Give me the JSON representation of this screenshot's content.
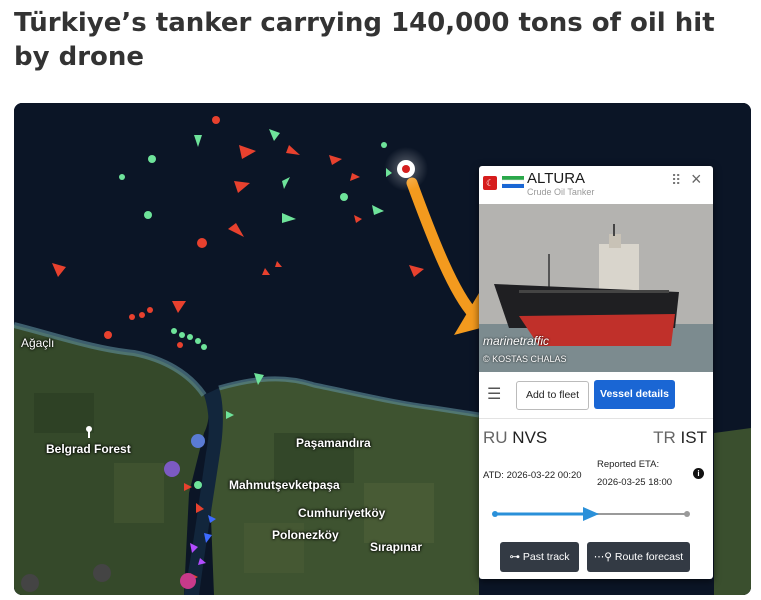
{
  "headline": "Türkiye’s tanker carrying 140,000 tons of oil hit by drone",
  "map": {
    "place_labels": {
      "agacli": "Ağaçlı",
      "belgrad": "Belgrad Forest",
      "pasamandira": "Paşamandıra",
      "mahmutsevketpasa": "Mahmutşevketpaşa",
      "cumhuriyetkoy": "Cumhuriyetköy",
      "polonezkoy": "Polonezköy",
      "sirapinar": "Sırapınar"
    },
    "colors": {
      "sea": "#0b1526",
      "land": "#35492a",
      "vessel_tanker": "#e8412e",
      "vessel_cargo": "#6ee39a",
      "arrow": "#f39a1e"
    }
  },
  "vessel_card": {
    "flag_icon": "turkey-flag-icon",
    "type_icon": "tanker-type-icon",
    "name": "ALTURA",
    "type": "Crude Oil Tanker",
    "photo_watermark": "marinetraffic",
    "photo_credit": "© KOSTAS CHALAS",
    "menu_icon": "hamburger-icon",
    "add_to_fleet": "Add to fleet",
    "vessel_details": "Vessel details",
    "origin": {
      "country": "RU",
      "port": "NVS"
    },
    "destination": {
      "country": "TR",
      "port": "IST"
    },
    "atd_label": "ATD: 2026-03-22 00:20",
    "eta_label": "Reported ETA:",
    "eta_value": "2026-03-25 18:00",
    "progress": 0.5,
    "past_track": "Past track",
    "route_forecast": "Route forecast",
    "accent": "#1a66d4",
    "progress_color": "#2a90d9"
  }
}
